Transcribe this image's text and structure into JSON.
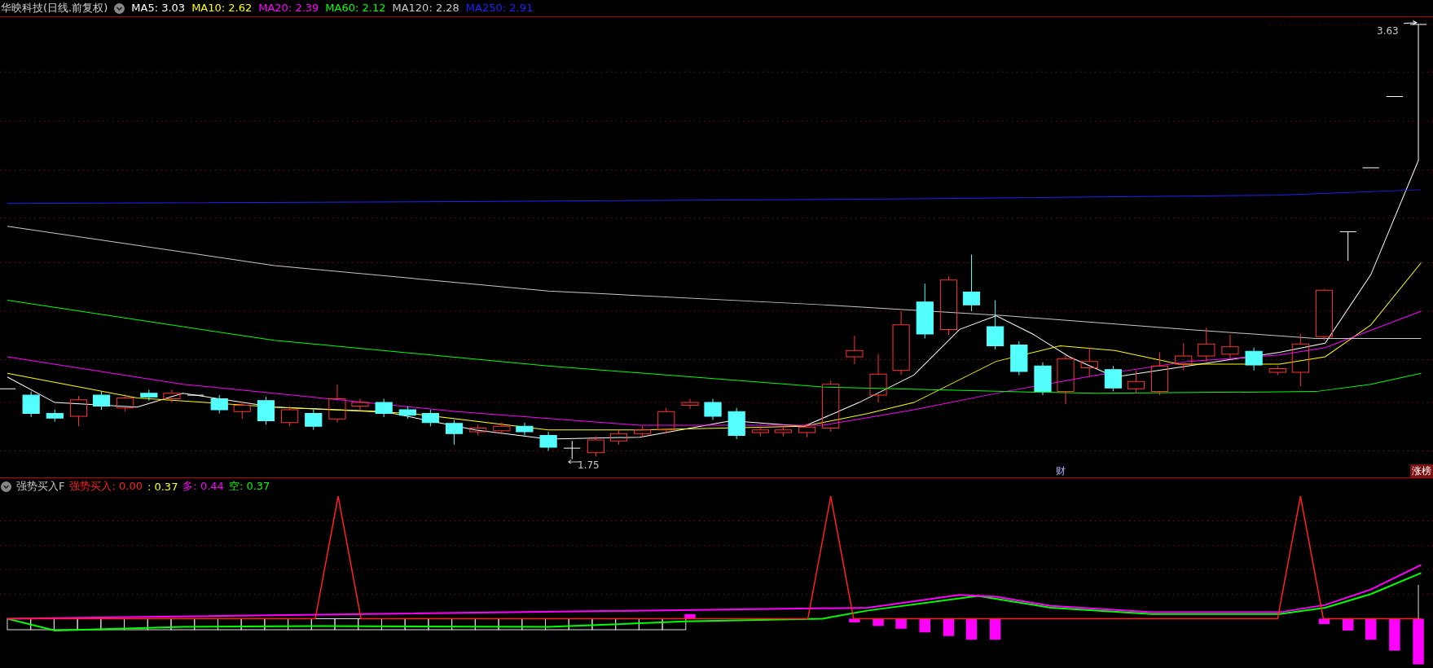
{
  "title": "华映科技(日线.前复权)",
  "ma_legend": [
    {
      "label": "MA5: 3.03",
      "color": "#ffffff"
    },
    {
      "label": "MA10: 2.62",
      "color": "#ffff00"
    },
    {
      "label": "MA20: 2.39",
      "color": "#ff00ff"
    },
    {
      "label": "MA60: 2.12",
      "color": "#00ff00"
    },
    {
      "label": "MA120: 2.28",
      "color": "#c8c8c8"
    },
    {
      "label": "MA250: 2.91",
      "color": "#2020ff"
    }
  ],
  "high_label": "3.63",
  "low_label": "1.75",
  "finance_marker": "财",
  "rank_badge": "涨榜",
  "indicator": {
    "name": "强势买入F",
    "values": [
      {
        "label": "强势买入: 0.00",
        "color": "#ff2020"
      },
      {
        "label": ": 0.37",
        "color": "#ffff00"
      },
      {
        "label": "多: 0.44",
        "color": "#ff00ff"
      },
      {
        "label": "空: 0.37",
        "color": "#00ff00"
      }
    ]
  }
}
